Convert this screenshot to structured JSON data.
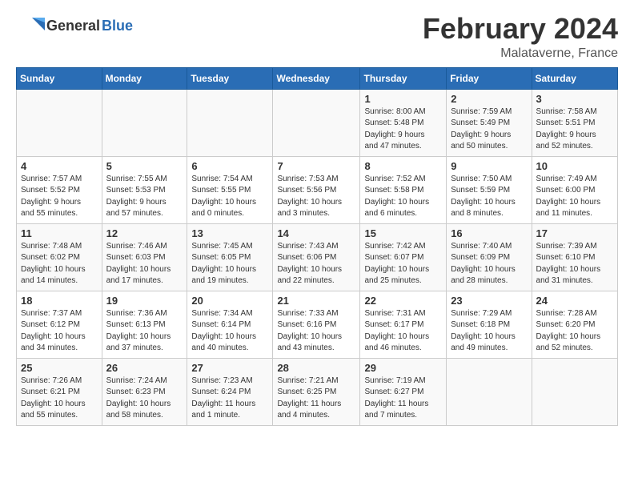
{
  "header": {
    "logo_general": "General",
    "logo_blue": "Blue",
    "title": "February 2024",
    "subtitle": "Malataverne, France"
  },
  "columns": [
    "Sunday",
    "Monday",
    "Tuesday",
    "Wednesday",
    "Thursday",
    "Friday",
    "Saturday"
  ],
  "weeks": [
    [
      {
        "day": "",
        "info": ""
      },
      {
        "day": "",
        "info": ""
      },
      {
        "day": "",
        "info": ""
      },
      {
        "day": "",
        "info": ""
      },
      {
        "day": "1",
        "info": "Sunrise: 8:00 AM\nSunset: 5:48 PM\nDaylight: 9 hours\nand 47 minutes."
      },
      {
        "day": "2",
        "info": "Sunrise: 7:59 AM\nSunset: 5:49 PM\nDaylight: 9 hours\nand 50 minutes."
      },
      {
        "day": "3",
        "info": "Sunrise: 7:58 AM\nSunset: 5:51 PM\nDaylight: 9 hours\nand 52 minutes."
      }
    ],
    [
      {
        "day": "4",
        "info": "Sunrise: 7:57 AM\nSunset: 5:52 PM\nDaylight: 9 hours\nand 55 minutes."
      },
      {
        "day": "5",
        "info": "Sunrise: 7:55 AM\nSunset: 5:53 PM\nDaylight: 9 hours\nand 57 minutes."
      },
      {
        "day": "6",
        "info": "Sunrise: 7:54 AM\nSunset: 5:55 PM\nDaylight: 10 hours\nand 0 minutes."
      },
      {
        "day": "7",
        "info": "Sunrise: 7:53 AM\nSunset: 5:56 PM\nDaylight: 10 hours\nand 3 minutes."
      },
      {
        "day": "8",
        "info": "Sunrise: 7:52 AM\nSunset: 5:58 PM\nDaylight: 10 hours\nand 6 minutes."
      },
      {
        "day": "9",
        "info": "Sunrise: 7:50 AM\nSunset: 5:59 PM\nDaylight: 10 hours\nand 8 minutes."
      },
      {
        "day": "10",
        "info": "Sunrise: 7:49 AM\nSunset: 6:00 PM\nDaylight: 10 hours\nand 11 minutes."
      }
    ],
    [
      {
        "day": "11",
        "info": "Sunrise: 7:48 AM\nSunset: 6:02 PM\nDaylight: 10 hours\nand 14 minutes."
      },
      {
        "day": "12",
        "info": "Sunrise: 7:46 AM\nSunset: 6:03 PM\nDaylight: 10 hours\nand 17 minutes."
      },
      {
        "day": "13",
        "info": "Sunrise: 7:45 AM\nSunset: 6:05 PM\nDaylight: 10 hours\nand 19 minutes."
      },
      {
        "day": "14",
        "info": "Sunrise: 7:43 AM\nSunset: 6:06 PM\nDaylight: 10 hours\nand 22 minutes."
      },
      {
        "day": "15",
        "info": "Sunrise: 7:42 AM\nSunset: 6:07 PM\nDaylight: 10 hours\nand 25 minutes."
      },
      {
        "day": "16",
        "info": "Sunrise: 7:40 AM\nSunset: 6:09 PM\nDaylight: 10 hours\nand 28 minutes."
      },
      {
        "day": "17",
        "info": "Sunrise: 7:39 AM\nSunset: 6:10 PM\nDaylight: 10 hours\nand 31 minutes."
      }
    ],
    [
      {
        "day": "18",
        "info": "Sunrise: 7:37 AM\nSunset: 6:12 PM\nDaylight: 10 hours\nand 34 minutes."
      },
      {
        "day": "19",
        "info": "Sunrise: 7:36 AM\nSunset: 6:13 PM\nDaylight: 10 hours\nand 37 minutes."
      },
      {
        "day": "20",
        "info": "Sunrise: 7:34 AM\nSunset: 6:14 PM\nDaylight: 10 hours\nand 40 minutes."
      },
      {
        "day": "21",
        "info": "Sunrise: 7:33 AM\nSunset: 6:16 PM\nDaylight: 10 hours\nand 43 minutes."
      },
      {
        "day": "22",
        "info": "Sunrise: 7:31 AM\nSunset: 6:17 PM\nDaylight: 10 hours\nand 46 minutes."
      },
      {
        "day": "23",
        "info": "Sunrise: 7:29 AM\nSunset: 6:18 PM\nDaylight: 10 hours\nand 49 minutes."
      },
      {
        "day": "24",
        "info": "Sunrise: 7:28 AM\nSunset: 6:20 PM\nDaylight: 10 hours\nand 52 minutes."
      }
    ],
    [
      {
        "day": "25",
        "info": "Sunrise: 7:26 AM\nSunset: 6:21 PM\nDaylight: 10 hours\nand 55 minutes."
      },
      {
        "day": "26",
        "info": "Sunrise: 7:24 AM\nSunset: 6:23 PM\nDaylight: 10 hours\nand 58 minutes."
      },
      {
        "day": "27",
        "info": "Sunrise: 7:23 AM\nSunset: 6:24 PM\nDaylight: 11 hours\nand 1 minute."
      },
      {
        "day": "28",
        "info": "Sunrise: 7:21 AM\nSunset: 6:25 PM\nDaylight: 11 hours\nand 4 minutes."
      },
      {
        "day": "29",
        "info": "Sunrise: 7:19 AM\nSunset: 6:27 PM\nDaylight: 11 hours\nand 7 minutes."
      },
      {
        "day": "",
        "info": ""
      },
      {
        "day": "",
        "info": ""
      }
    ]
  ]
}
